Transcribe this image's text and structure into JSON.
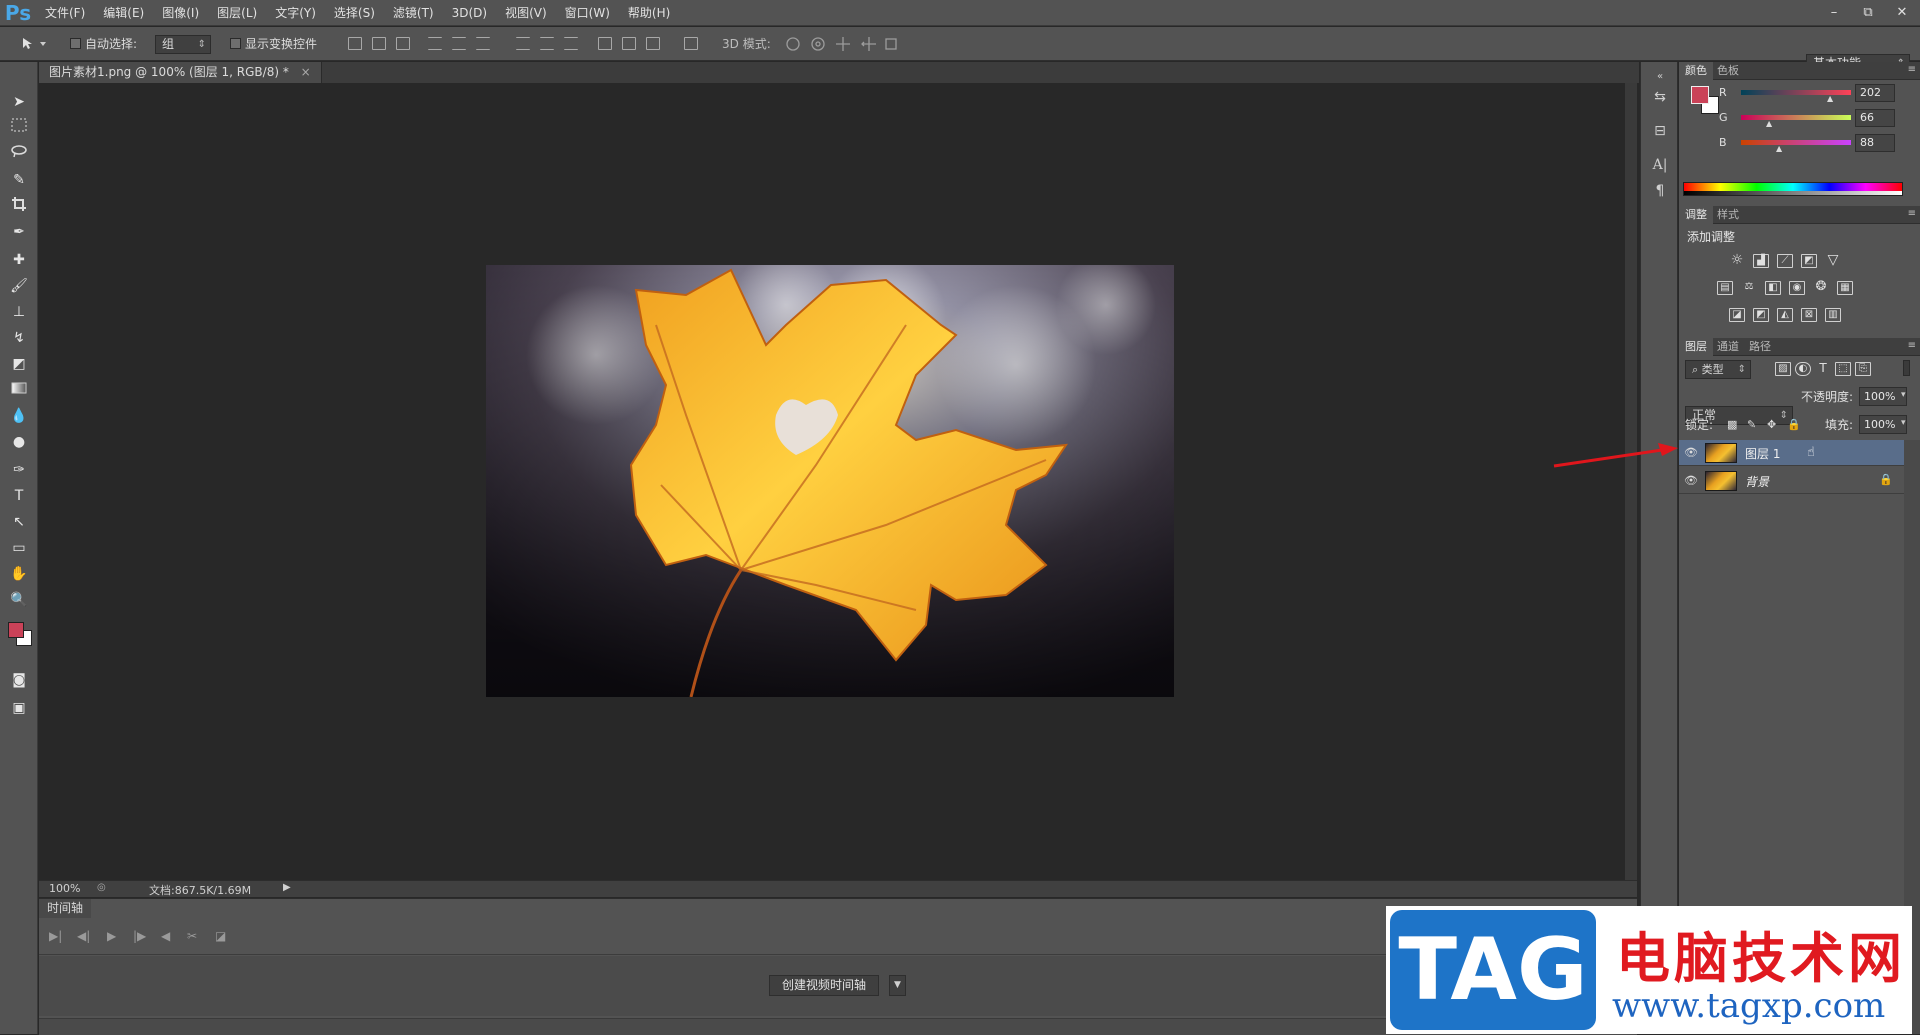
{
  "app": {
    "logo": "Ps"
  },
  "menu": [
    "文件(F)",
    "编辑(E)",
    "图像(I)",
    "图层(L)",
    "文字(Y)",
    "选择(S)",
    "滤镜(T)",
    "3D(D)",
    "视图(V)",
    "窗口(W)",
    "帮助(H)"
  ],
  "window_controls": {
    "minimize": "–",
    "restore": "⧉",
    "close": "✕"
  },
  "options": {
    "auto_select_label": "自动选择:",
    "auto_select_value": "组",
    "show_transform_label": "显示变换控件",
    "mode_3d_label": "3D 模式:",
    "workspace": "基本功能"
  },
  "document": {
    "tab_title": "图片素材1.png @ 100% (图层 1, RGB/8) *",
    "tab_close": "×",
    "zoom": "100%",
    "doc_size": "文档:867.5K/1.69M"
  },
  "timeline": {
    "tab": "时间轴",
    "create_button": "创建视频时间轴"
  },
  "color_panel": {
    "tabs": [
      "颜色",
      "色板"
    ],
    "r_label": "R",
    "r_value": "202",
    "g_label": "G",
    "g_value": "66",
    "b_label": "B",
    "b_value": "88",
    "foreground": "#ca4258",
    "background": "#ffffff"
  },
  "adjust_panel": {
    "tabs": [
      "调整",
      "样式"
    ],
    "heading": "添加调整"
  },
  "layers_panel": {
    "tabs": [
      "图层",
      "通道",
      "路径"
    ],
    "filter_kind": "类型",
    "blend_mode": "正常",
    "opacity_label": "不透明度:",
    "opacity_value": "100%",
    "lock_label": "锁定:",
    "fill_label": "填充:",
    "fill_value": "100%",
    "layers": [
      {
        "name": "图层 1",
        "selected": true,
        "locked": false
      },
      {
        "name": "背景",
        "selected": false,
        "locked": true
      }
    ]
  },
  "watermark": {
    "badge": "TAG",
    "site_name": "电脑技术网",
    "url": "www.tagxp.com"
  }
}
